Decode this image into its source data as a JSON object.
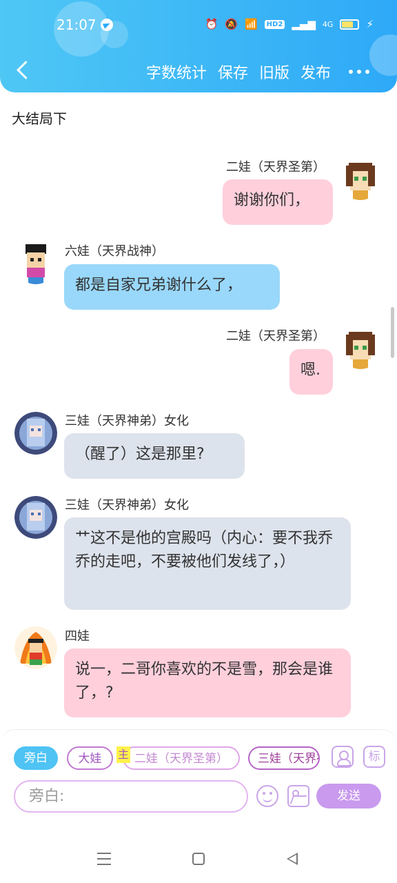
{
  "status_bar": {
    "time": "21:07",
    "network_badge": "HD2",
    "network_type": "4G"
  },
  "header": {
    "actions": [
      "字数统计",
      "保存",
      "旧版",
      "发布"
    ],
    "theme_color": "#2ea9f7"
  },
  "chapter_title": "大结局下",
  "messages": [
    {
      "speaker": "二娃（天界圣第）",
      "text": "谢谢你们，",
      "side": "right",
      "color": "pink"
    },
    {
      "speaker": "六娃（天界战神）",
      "text": "都是自家兄弟谢什么了，",
      "side": "left",
      "color": "blue"
    },
    {
      "speaker": "二娃（天界圣第）",
      "text": "嗯.",
      "side": "right",
      "color": "pink"
    },
    {
      "speaker": "三娃（天界神弟）女化",
      "text": "（醒了）这是那里?",
      "side": "left",
      "color": "gray"
    },
    {
      "speaker": "三娃（天界神弟）女化",
      "text": "艹这不是他的宫殿吗（内心：要不我乔乔的走吧，不要被他们发线了，）",
      "side": "left",
      "color": "gray"
    },
    {
      "speaker": "四娃",
      "text": "说一，二哥你喜欢的不是雪，那会是谁了，?",
      "side": "left",
      "color": "pink"
    }
  ],
  "input_panel": {
    "roles": [
      "旁白",
      "大娃",
      "二娃（天界圣第）",
      "三娃（天界神弟）女化"
    ],
    "main_tag": "主",
    "tag_button": "标",
    "input_placeholder": "旁白:",
    "send_label": "发送"
  }
}
